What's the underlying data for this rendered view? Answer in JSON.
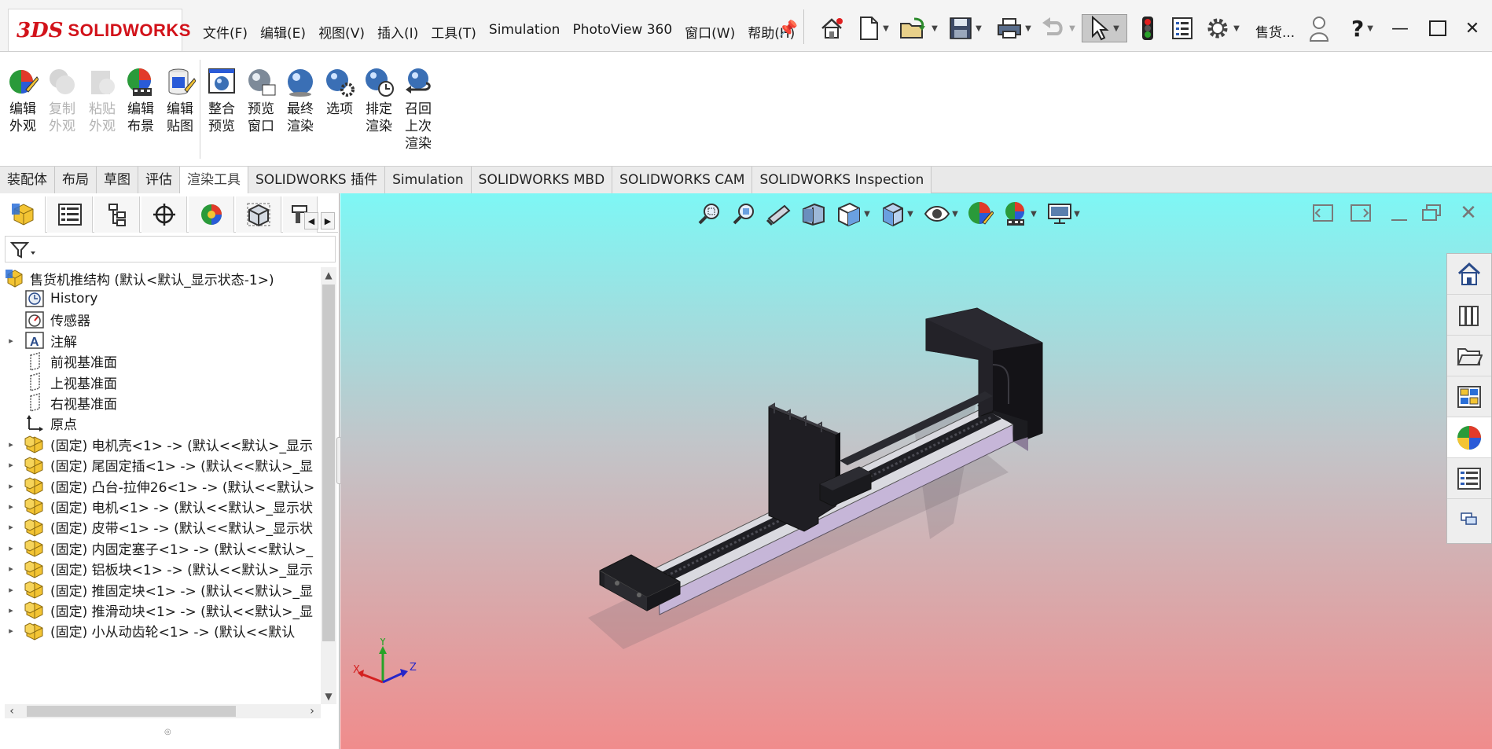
{
  "app": {
    "logo_text": "SOLIDWORKS",
    "logo_mark": "3DS",
    "brand_color": "#d2121a"
  },
  "menu": [
    {
      "label": "文件(F)"
    },
    {
      "label": "编辑(E)"
    },
    {
      "label": "视图(V)"
    },
    {
      "label": "插入(I)"
    },
    {
      "label": "工具(T)"
    },
    {
      "label": "Simulation"
    },
    {
      "label": "PhotoView 360"
    },
    {
      "label": "窗口(W)"
    },
    {
      "label": "帮助(H)"
    }
  ],
  "quick_access": {
    "icons": [
      "home-icon",
      "new-document-icon",
      "open-icon",
      "save-icon",
      "print-icon",
      "undo-icon",
      "select-cursor-icon",
      "rebuild-traffic-light-icon",
      "file-properties-icon",
      "options-gear-icon"
    ],
    "user_label": "售货...",
    "help_label": "?"
  },
  "ribbon": {
    "buttons": [
      {
        "label": "编辑\n外观",
        "icon": "edit-appearance-icon",
        "enabled": true
      },
      {
        "label": "复制\n外观",
        "icon": "copy-appearance-icon",
        "enabled": false
      },
      {
        "label": "粘贴\n外观",
        "icon": "paste-appearance-icon",
        "enabled": false
      },
      {
        "label": "编辑\n布景",
        "icon": "edit-scene-icon",
        "enabled": true
      },
      {
        "label": "编辑\n贴图",
        "icon": "edit-decal-icon",
        "enabled": true
      },
      {
        "label": "整合\n预览",
        "icon": "integrated-preview-icon",
        "enabled": true
      },
      {
        "label": "预览\n窗口",
        "icon": "preview-window-icon",
        "enabled": true
      },
      {
        "label": "最终\n渲染",
        "icon": "final-render-icon",
        "enabled": true
      },
      {
        "label": "选项",
        "icon": "render-options-icon",
        "enabled": true
      },
      {
        "label": "排定\n渲染",
        "icon": "schedule-render-icon",
        "enabled": true
      },
      {
        "label": "召回\n上次\n渲染",
        "icon": "recall-last-render-icon",
        "enabled": true
      }
    ]
  },
  "tabs": [
    {
      "label": "装配体",
      "active": false
    },
    {
      "label": "布局",
      "active": false
    },
    {
      "label": "草图",
      "active": false
    },
    {
      "label": "评估",
      "active": false
    },
    {
      "label": "渲染工具",
      "active": true
    },
    {
      "label": "SOLIDWORKS 插件",
      "active": false
    },
    {
      "label": "Simulation",
      "active": false
    },
    {
      "label": "SOLIDWORKS MBD",
      "active": false
    },
    {
      "label": "SOLIDWORKS CAM",
      "active": false
    },
    {
      "label": "SOLIDWORKS Inspection",
      "active": false
    }
  ],
  "feature_manager": {
    "panel_tabs": [
      "featuremanager-tree-icon",
      "propertymanager-icon",
      "configurationmanager-icon",
      "dimxpert-icon",
      "displaymanager-icon",
      "cam-icon",
      "cam-tree-icon"
    ],
    "tree": [
      {
        "label": "售货机推结构  (默认<默认_显示状态-1>)",
        "icon": "assembly-icon",
        "expander": "",
        "indent": 0
      },
      {
        "label": "History",
        "icon": "history-icon",
        "expander": "",
        "indent": 1
      },
      {
        "label": "传感器",
        "icon": "sensor-icon",
        "expander": "",
        "indent": 1
      },
      {
        "label": "注解",
        "icon": "annotation-icon",
        "expander": "▸",
        "indent": 1
      },
      {
        "label": "前视基准面",
        "icon": "plane-icon",
        "expander": "",
        "indent": 1
      },
      {
        "label": "上视基准面",
        "icon": "plane-icon",
        "expander": "",
        "indent": 1
      },
      {
        "label": "右视基准面",
        "icon": "plane-icon",
        "expander": "",
        "indent": 1
      },
      {
        "label": "原点",
        "icon": "origin-icon",
        "expander": "",
        "indent": 1
      },
      {
        "label": "(固定) 电机壳<1> -> (默认<<默认>_显示",
        "icon": "part-icon",
        "expander": "▸",
        "indent": 1
      },
      {
        "label": "(固定) 尾固定插<1> -> (默认<<默认>_显",
        "icon": "part-icon",
        "expander": "▸",
        "indent": 1
      },
      {
        "label": "(固定) 凸台-拉伸26<1> -> (默认<<默认>",
        "icon": "part-icon",
        "expander": "▸",
        "indent": 1
      },
      {
        "label": "(固定) 电机<1> -> (默认<<默认>_显示状",
        "icon": "part-icon",
        "expander": "▸",
        "indent": 1
      },
      {
        "label": "(固定) 皮带<1> -> (默认<<默认>_显示状",
        "icon": "part-icon",
        "expander": "▸",
        "indent": 1
      },
      {
        "label": "(固定) 内固定塞子<1> -> (默认<<默认>_",
        "icon": "part-icon",
        "expander": "▸",
        "indent": 1
      },
      {
        "label": "(固定) 铝板块<1> -> (默认<<默认>_显示",
        "icon": "part-icon",
        "expander": "▸",
        "indent": 1
      },
      {
        "label": "(固定) 推固定块<1> -> (默认<<默认>_显",
        "icon": "part-icon",
        "expander": "▸",
        "indent": 1
      },
      {
        "label": "(固定) 推滑动块<1> -> (默认<<默认>_显",
        "icon": "part-icon",
        "expander": "▸",
        "indent": 1
      },
      {
        "label": "(固定) 小从动齿轮<1> -> (默认<<默认",
        "icon": "part-icon",
        "expander": "▸",
        "indent": 1
      }
    ]
  },
  "view_toolbar": {
    "icons": [
      "zoom-to-fit-icon",
      "zoom-to-area-icon",
      "previous-view-icon",
      "section-view-icon",
      "view-orientation-icon",
      "display-style-icon",
      "hide-show-items-icon",
      "edit-appearance-icon",
      "apply-scene-icon",
      "view-settings-icon"
    ]
  },
  "task_pane": {
    "icons": [
      "solidworks-resources-icon",
      "design-library-icon",
      "file-explorer-icon",
      "view-palette-icon",
      "appearances-scenes-icon",
      "custom-properties-icon",
      "forum-icon"
    ]
  },
  "triad": {
    "x_label": "X",
    "y_label": "Y",
    "z_label": "Z"
  },
  "colors": {
    "viewport_top": "#7ef7f5",
    "viewport_bottom": "#f08c8c",
    "model_dark": "#1e1d22",
    "rail_silver": "#d9d9df",
    "rail_purple": "#c6b6d8"
  }
}
